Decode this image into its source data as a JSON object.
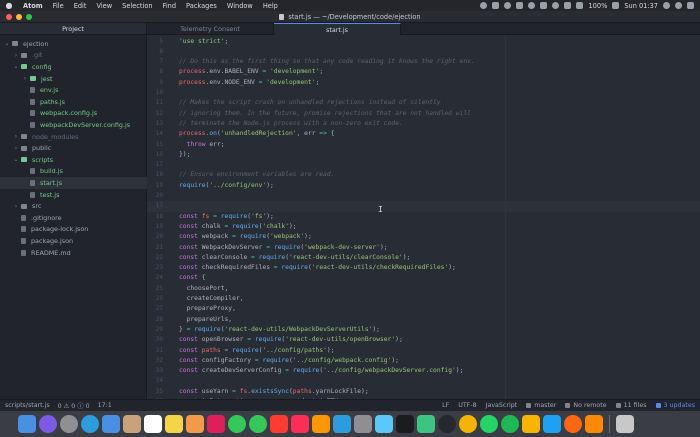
{
  "menubar": {
    "apple": "",
    "items": [
      "Atom",
      "File",
      "Edit",
      "View",
      "Selection",
      "Find",
      "Packages",
      "Window",
      "Help"
    ],
    "battery": "100%",
    "clock": "Sun 01:37"
  },
  "window": {
    "title": "start.js — ~/Development/code/ejection"
  },
  "tree": {
    "header": "Project",
    "items": [
      {
        "label": "ejection",
        "kind": "folder",
        "open": true,
        "level": 0
      },
      {
        "label": ".git",
        "kind": "folder",
        "open": false,
        "level": 1
      },
      {
        "label": "config",
        "kind": "folder",
        "open": true,
        "level": 1
      },
      {
        "label": "jest",
        "kind": "folder",
        "open": false,
        "level": 2
      },
      {
        "label": "env.js",
        "kind": "file",
        "level": 2
      },
      {
        "label": "paths.js",
        "kind": "file",
        "level": 2
      },
      {
        "label": "webpack.config.js",
        "kind": "file",
        "level": 2
      },
      {
        "label": "webpackDevServer.config.js",
        "kind": "file",
        "level": 2
      },
      {
        "label": "node_modules",
        "kind": "folder",
        "open": false,
        "level": 1
      },
      {
        "label": "public",
        "kind": "folder",
        "open": false,
        "level": 1
      },
      {
        "label": "scripts",
        "kind": "folder",
        "open": true,
        "level": 1
      },
      {
        "label": "build.js",
        "kind": "file",
        "level": 2
      },
      {
        "label": "start.js",
        "kind": "file",
        "level": 2,
        "selected": true
      },
      {
        "label": "test.js",
        "kind": "file",
        "level": 2
      },
      {
        "label": "src",
        "kind": "folder",
        "open": false,
        "level": 1
      },
      {
        "label": ".gitignore",
        "kind": "file",
        "level": 1
      },
      {
        "label": "package-lock.json",
        "kind": "file",
        "level": 1
      },
      {
        "label": "package.json",
        "kind": "file",
        "level": 1
      },
      {
        "label": "README.md",
        "kind": "file",
        "level": 1
      }
    ]
  },
  "tabs": [
    {
      "label": "Telemetry Consent",
      "active": false
    },
    {
      "label": "start.js",
      "active": true
    }
  ],
  "editor": {
    "cursor_line": 17,
    "lines": [
      {
        "n": "5",
        "t": "'use strict';"
      },
      {
        "n": "6",
        "t": ""
      },
      {
        "n": "7",
        "t": "// Do this as the first thing so that any code reading it knows the right env."
      },
      {
        "n": "8",
        "t": "process.env.BABEL_ENV = 'development';"
      },
      {
        "n": "9",
        "t": "process.env.NODE_ENV = 'development';"
      },
      {
        "n": "10",
        "t": ""
      },
      {
        "n": "11",
        "t": "// Makes the script crash on unhandled rejections instead of silently"
      },
      {
        "n": "12",
        "t": "// ignoring them. In the future, promise rejections that are not handled will"
      },
      {
        "n": "13",
        "t": "// terminate the Node.js process with a non-zero exit code."
      },
      {
        "n": "14",
        "t": "process.on('unhandledRejection', err => {"
      },
      {
        "n": "15",
        "t": "  throw err;"
      },
      {
        "n": "16",
        "t": "});"
      },
      {
        "n": "17",
        "t": ""
      },
      {
        "n": "18",
        "t": "// Ensure environment variables are read."
      },
      {
        "n": "19",
        "t": "require('../config/env');"
      },
      {
        "n": "20",
        "t": ""
      },
      {
        "n": "17",
        "t": ""
      },
      {
        "n": "18",
        "t": "const fs = require('fs');"
      },
      {
        "n": "19",
        "t": "const chalk = require('chalk');"
      },
      {
        "n": "20",
        "t": "const webpack = require('webpack');"
      },
      {
        "n": "21",
        "t": "const WebpackDevServer = require('webpack-dev-server');"
      },
      {
        "n": "22",
        "t": "const clearConsole = require('react-dev-utils/clearConsole');"
      },
      {
        "n": "23",
        "t": "const checkRequiredFiles = require('react-dev-utils/checkRequiredFiles');"
      },
      {
        "n": "24",
        "t": "const {"
      },
      {
        "n": "25",
        "t": "  choosePort,"
      },
      {
        "n": "26",
        "t": "  createCompiler,"
      },
      {
        "n": "27",
        "t": "  prepareProxy,"
      },
      {
        "n": "28",
        "t": "  prepareUrls,"
      },
      {
        "n": "29",
        "t": "} = require('react-dev-utils/WebpackDevServerUtils');"
      },
      {
        "n": "30",
        "t": "const openBrowser = require('react-dev-utils/openBrowser');"
      },
      {
        "n": "31",
        "t": "const paths = require('../config/paths');"
      },
      {
        "n": "32",
        "t": "const configFactory = require('../config/webpack.config');"
      },
      {
        "n": "33",
        "t": "const createDevServerConfig = require('../config/webpackDevServer.config');"
      },
      {
        "n": "34",
        "t": ""
      },
      {
        "n": "35",
        "t": "const useYarn = fs.existsSync(paths.yarnLockFile);"
      },
      {
        "n": "36",
        "t": "const isInteractive = process.stdout.isTTY;"
      }
    ]
  },
  "statusbar": {
    "path": "scripts/start.js",
    "diagnostics": "0 ⚠ 0 ⓘ 0",
    "position": "17:1",
    "line_ending": "LF",
    "encoding": "UTF-8",
    "grammar": "JavaScript",
    "branch": "master",
    "remote": "No remote",
    "files": "11 files",
    "updates": "3 updates"
  },
  "dock": {
    "icons": [
      "finder-icon",
      "siri-icon",
      "launchpad-icon",
      "safari-icon",
      "mail-icon",
      "contacts-icon",
      "calendar-icon",
      "notes-icon",
      "photos-icon",
      "slack-icon",
      "facetime-icon",
      "messages-icon",
      "news-icon",
      "music-icon",
      "books-icon",
      "app-store-icon",
      "system-preferences-icon",
      "xcode-icon",
      "terminal-icon",
      "atom-icon",
      "github-icon",
      "chrome-icon",
      "whatsapp-icon",
      "spotify-icon",
      "sketch-icon",
      "tweetbot-icon",
      "firefox-icon",
      "vlc-icon",
      "trash-icon"
    ],
    "colors": [
      "#4a90e2",
      "#7b5be0",
      "#8e8e93",
      "#2d9cdb",
      "#4a90e2",
      "#c8a27a",
      "#ffffff",
      "#f5d547",
      "#f2994a",
      "#e01e5a",
      "#34c759",
      "#34c759",
      "#ff3b30",
      "#ff2d55",
      "#ff9500",
      "#2d9cdb",
      "#8e8e93",
      "#5ac8fa",
      "#1c1c1e",
      "#3fc380",
      "#24292e",
      "#f4b400",
      "#25d366",
      "#1db954",
      "#f7b500",
      "#1da1f2",
      "#ff6611",
      "#ff8800",
      "#c7c7cc"
    ]
  },
  "colors": {
    "accent": "#568af2",
    "git_added": "#73c990"
  }
}
